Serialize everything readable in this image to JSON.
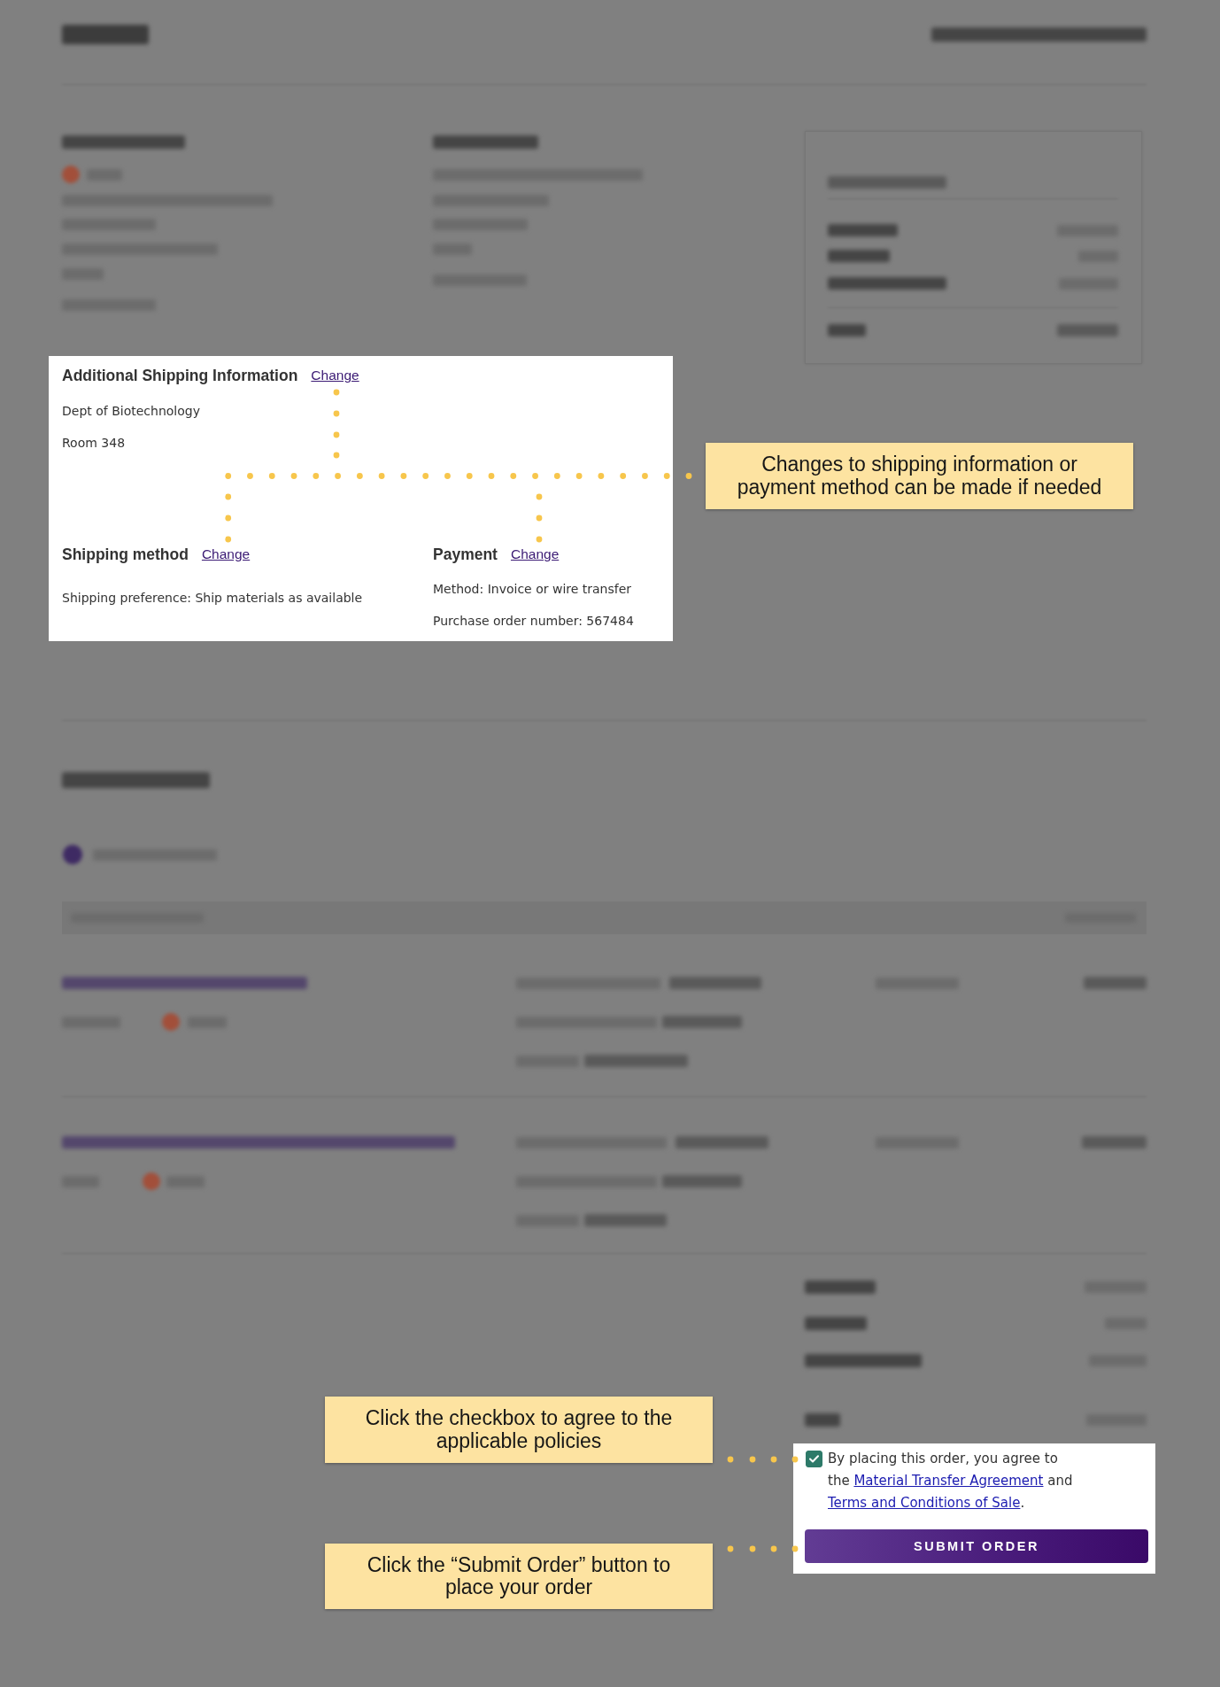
{
  "shipping_panel": {
    "blocks": [
      {
        "title": "Additional Shipping Information",
        "change_link": "Change",
        "lines": [
          "Dept of Biotechnology",
          "Room 348"
        ]
      },
      {
        "title": "Shipping method",
        "change_link": "Change",
        "lines": [
          "Shipping preference: Ship materials as available"
        ]
      },
      {
        "title": "Payment",
        "change_link": "Change",
        "lines": [
          "Method: Invoice or wire transfer",
          "Purchase order number: 567484"
        ]
      }
    ]
  },
  "callouts": [
    {
      "text": "Changes to shipping information or payment method can be made if needed"
    },
    {
      "text": "Click the checkbox to agree to the applicable policies"
    },
    {
      "text": "Click the “Submit Order” button to place your order"
    }
  ],
  "agreement": {
    "checked": true,
    "parts": [
      {
        "kind": "text",
        "text": "By placing this order, you agree to the "
      },
      {
        "kind": "link",
        "text": "Material Transfer Agreement"
      },
      {
        "kind": "text",
        "text": " and "
      },
      {
        "kind": "link",
        "text": "Terms and Conditions of Sale"
      },
      {
        "kind": "text",
        "text": "."
      }
    ]
  },
  "submit_button": {
    "label": "SUBMIT ORDER"
  }
}
